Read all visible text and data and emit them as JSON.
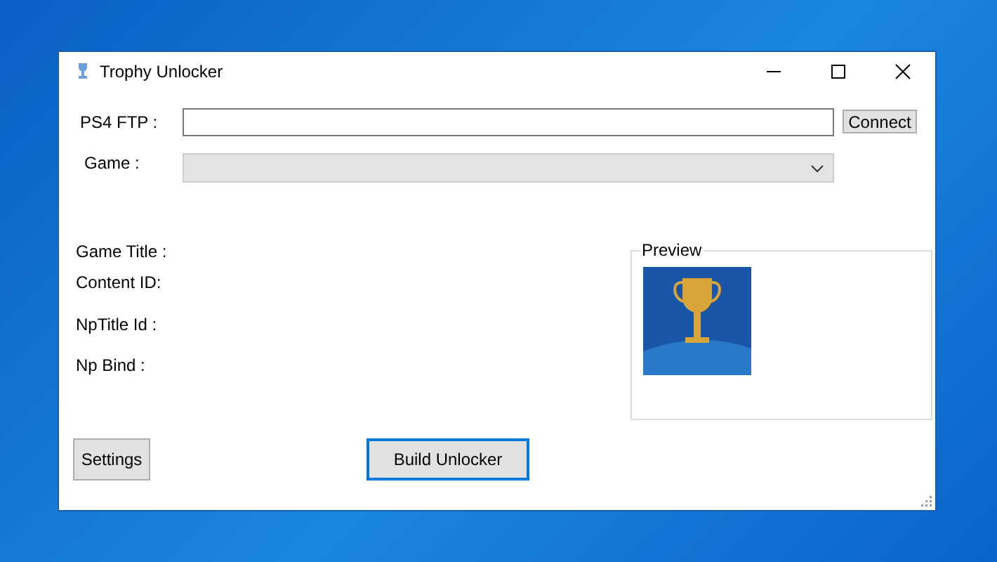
{
  "window": {
    "title": "Trophy Unlocker"
  },
  "ftp": {
    "label": "PS4 FTP :",
    "button": "Connect"
  },
  "game": {
    "label": "Game :",
    "disabled": true
  },
  "info_labels": [
    "Game Title :",
    "Content ID:",
    "NpTitle Id :",
    "Np Bind :"
  ],
  "preview": {
    "label": "Preview"
  },
  "buttons": [
    {
      "label": "Settings",
      "focused": false
    },
    {
      "label": "Build Unlocker",
      "focused": true
    }
  ]
}
